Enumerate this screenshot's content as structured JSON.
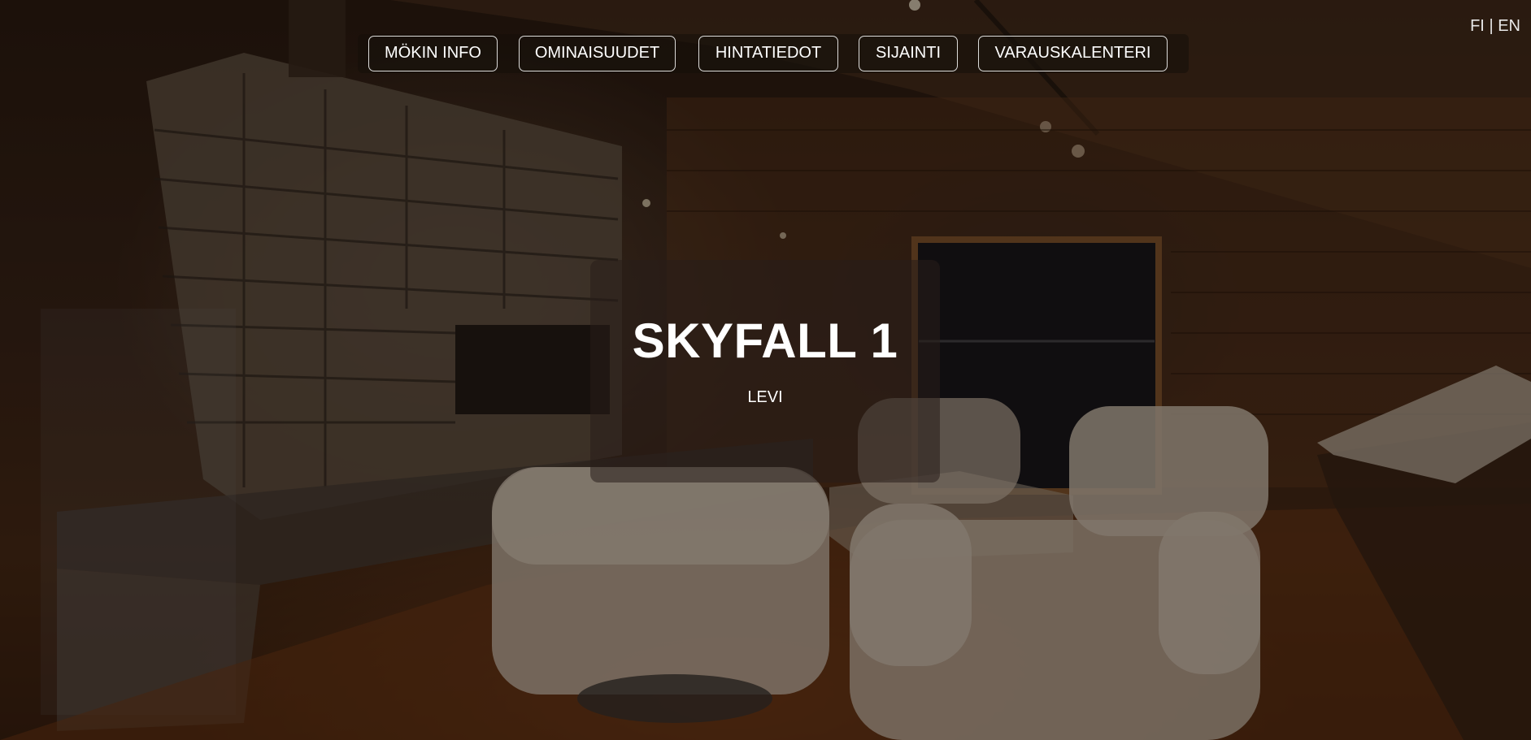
{
  "nav": {
    "items": [
      {
        "label": "MÖKIN INFO"
      },
      {
        "label": "OMINAISUUDET"
      },
      {
        "label": "HINTATIEDOT"
      },
      {
        "label": "SIJAINTI"
      },
      {
        "label": "VARAUSKALENTERI"
      }
    ]
  },
  "language": {
    "fi": "FI",
    "separator": "|",
    "en": "EN"
  },
  "hero": {
    "title": "SKYFALL 1",
    "subtitle": "LEVI"
  },
  "colors": {
    "text": "#ffffff",
    "overlay": "#0a0604"
  }
}
